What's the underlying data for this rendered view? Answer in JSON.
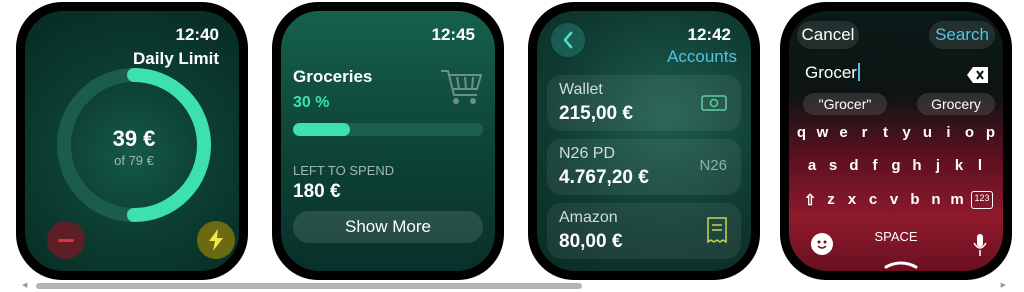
{
  "colors": {
    "accent": "#3de0b0",
    "bar_bg": "#1d5f4d",
    "minus_bg": "#5b1f25",
    "minus_fg": "#e0303c",
    "bolt_bg": "#6b6a12",
    "bolt_fg": "#f0e54a",
    "link": "#4fc3e8"
  },
  "screen1": {
    "time": "12:40",
    "title": "Daily Limit",
    "amount": "39 €",
    "of_label": "of 79 €",
    "progress": 0.5,
    "minus_icon": "minus-icon",
    "bolt_icon": "lightning-icon"
  },
  "screen2": {
    "time": "12:45",
    "category": "Groceries",
    "percent": "30 %",
    "progress": 0.3,
    "left_label": "LEFT TO SPEND",
    "left_amount": "180 €",
    "button": "Show More",
    "icon": "shopping-cart-icon"
  },
  "screen3": {
    "time": "12:42",
    "title": "Accounts",
    "back_icon": "chevron-left-icon",
    "accounts": [
      {
        "name": "Wallet",
        "value": "215,00 €",
        "icon": "cash-icon"
      },
      {
        "name": "N26 PD",
        "value": "4.767,20 €",
        "icon": "n26-icon",
        "icon_text": "N26"
      },
      {
        "name": "Amazon",
        "value": "80,00 €",
        "icon": "receipt-icon"
      }
    ]
  },
  "screen4": {
    "cancel": "Cancel",
    "search": "Search",
    "input": "Grocer",
    "suggestions": [
      "\"Grocer\"",
      "Grocery"
    ],
    "row1": [
      "q",
      "w",
      "e",
      "r",
      "t",
      "y",
      "u",
      "i",
      "o",
      "p"
    ],
    "row2": [
      "a",
      "s",
      "d",
      "f",
      "g",
      "h",
      "j",
      "k",
      "l"
    ],
    "row3": [
      "z",
      "x",
      "c",
      "v",
      "b",
      "n",
      "m"
    ],
    "space": "SPACE",
    "numbers_key": "123",
    "clear_icon": "delete-icon",
    "shift_icon": "shift-icon",
    "emoji_icon": "emoji-icon",
    "mic_icon": "microphone-icon"
  }
}
